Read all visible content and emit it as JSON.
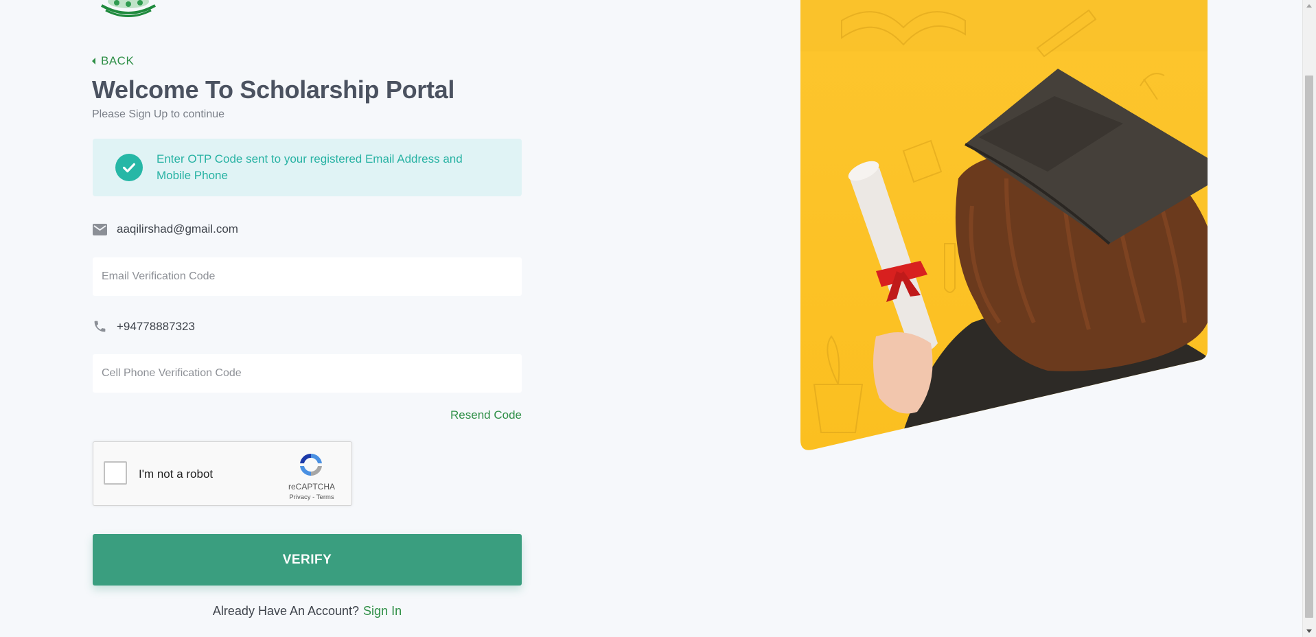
{
  "back": {
    "label": "BACK"
  },
  "heading": {
    "title": "Welcome To Scholarship Portal",
    "subtitle": "Please Sign Up to continue"
  },
  "alert": {
    "message": "Enter OTP Code sent to your registered Email Address and Mobile Phone",
    "icon": "check-circle-icon",
    "color": "#26b7a6"
  },
  "email": {
    "icon": "mail-icon",
    "address": "aaqilirshad@gmail.com",
    "code_placeholder": "Email Verification Code",
    "code_value": ""
  },
  "phone": {
    "icon": "phone-icon",
    "number": "+94778887323",
    "code_placeholder": "Cell Phone Verification Code",
    "code_value": ""
  },
  "resend": {
    "label": "Resend Code"
  },
  "captcha": {
    "label": "I'm not a robot",
    "brand": "reCAPTCHA",
    "privacy": "Privacy",
    "separator": "-",
    "terms": "Terms",
    "checked": false
  },
  "verify": {
    "label": "VERIFY",
    "color": "#3a9e7f"
  },
  "account": {
    "prompt": "Already Have An Account?",
    "link": "Sign In"
  },
  "colors": {
    "brand_green": "#2f8f47",
    "hero_yellow": "#fcc52a",
    "background": "#f6f8fb"
  }
}
